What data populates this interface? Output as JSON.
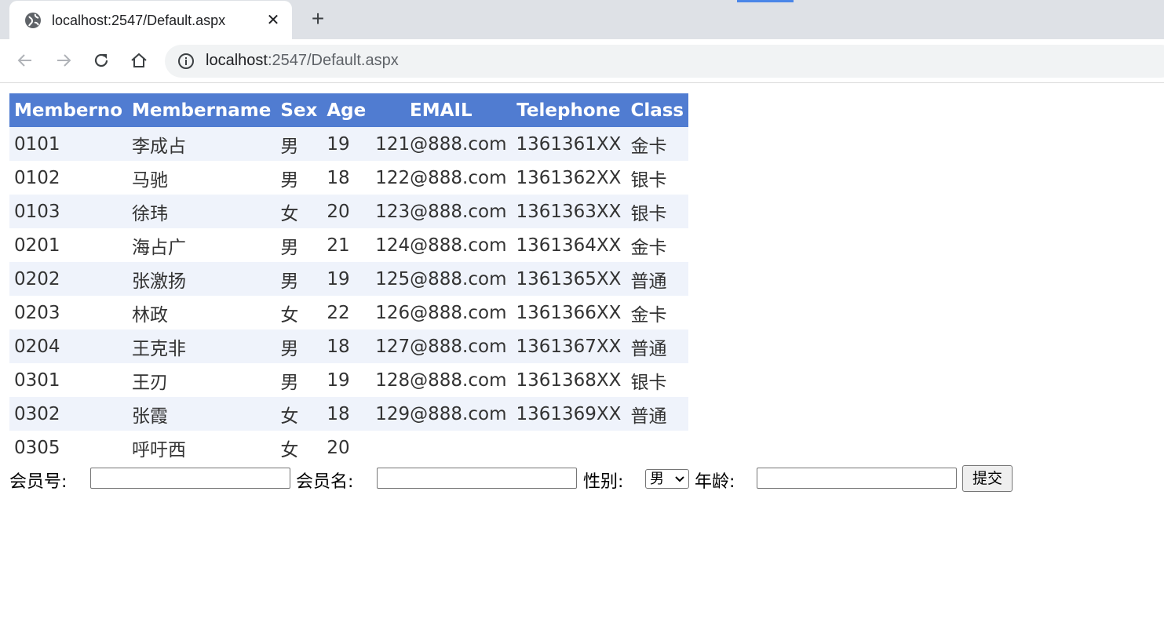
{
  "browser": {
    "tab_title": "localhost:2547/Default.aspx",
    "tab_close": "✕",
    "new_tab": "+",
    "url_host": "localhost",
    "url_rest": ":2547/Default.aspx",
    "icons": [
      "globe-icon",
      "close-icon",
      "plus-icon",
      "back-icon",
      "forward-icon",
      "reload-icon",
      "home-icon",
      "info-icon"
    ]
  },
  "table": {
    "columns": [
      "Memberno",
      "Membername",
      "Sex",
      "Age",
      "EMAIL",
      "Telephone",
      "Class"
    ],
    "rows": [
      {
        "memberno": "0101",
        "membername": "李成占",
        "sex": "男",
        "age": "19",
        "email": "121@888.com",
        "telephone": "1361361XX",
        "class": "金卡"
      },
      {
        "memberno": "0102",
        "membername": "马驰",
        "sex": "男",
        "age": "18",
        "email": "122@888.com",
        "telephone": "1361362XX",
        "class": "银卡"
      },
      {
        "memberno": "0103",
        "membername": "徐玮",
        "sex": "女",
        "age": "20",
        "email": "123@888.com",
        "telephone": "1361363XX",
        "class": "银卡"
      },
      {
        "memberno": "0201",
        "membername": "海占广",
        "sex": "男",
        "age": "21",
        "email": "124@888.com",
        "telephone": "1361364XX",
        "class": "金卡"
      },
      {
        "memberno": "0202",
        "membername": "张激扬",
        "sex": "男",
        "age": "19",
        "email": "125@888.com",
        "telephone": "1361365XX",
        "class": "普通"
      },
      {
        "memberno": "0203",
        "membername": "林政",
        "sex": "女",
        "age": "22",
        "email": "126@888.com",
        "telephone": "1361366XX",
        "class": "金卡"
      },
      {
        "memberno": "0204",
        "membername": "王克非",
        "sex": "男",
        "age": "18",
        "email": "127@888.com",
        "telephone": "1361367XX",
        "class": "普通"
      },
      {
        "memberno": "0301",
        "membername": "王刃",
        "sex": "男",
        "age": "19",
        "email": "128@888.com",
        "telephone": "1361368XX",
        "class": "银卡"
      },
      {
        "memberno": "0302",
        "membername": "张霞",
        "sex": "女",
        "age": "18",
        "email": "129@888.com",
        "telephone": "1361369XX",
        "class": "普通"
      },
      {
        "memberno": "0305",
        "membername": "呼吁西",
        "sex": "女",
        "age": "20",
        "email": "",
        "telephone": "",
        "class": ""
      }
    ],
    "colors": {
      "header_bg": "#507cd1",
      "alt_row_bg": "#eff3fb"
    }
  },
  "form": {
    "memberno_label": "会员号:",
    "memberno_value": "",
    "membername_label": "会员名:",
    "membername_value": "",
    "sex_label": "性别:",
    "sex_selected": "男",
    "age_label": "年龄:",
    "age_value": "",
    "submit_label": "提交"
  }
}
